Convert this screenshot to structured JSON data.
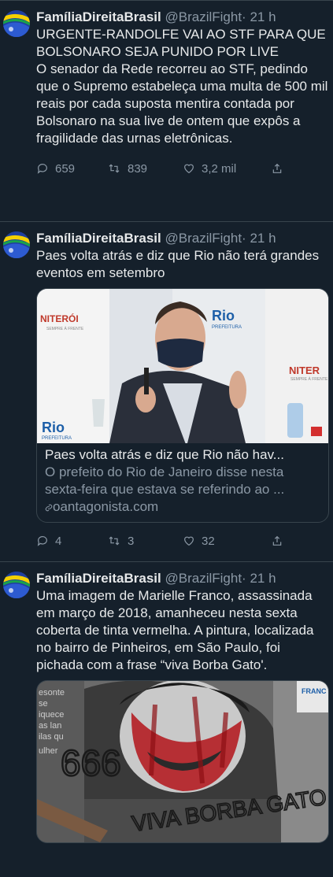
{
  "tweets": [
    {
      "name": "FamíliaDireitaBrasil",
      "handle": "@BrazilFight",
      "dot": "·",
      "time": "21 h",
      "lines": [
        "URGENTE-RANDOLFE VAI AO STF PARA QUE BOLSONARO SEJA PUNIDO POR LIVE",
        "O senador da Rede recorreu ao STF, pedindo que o Supremo estabeleça uma multa de 500 mil reais por cada suposta mentira contada por Bolsonaro na sua live de ontem que expôs a fragilidade das urnas eletrônicas."
      ],
      "replies": "659",
      "retweets": "839",
      "likes": "3,2 mil"
    },
    {
      "name": "FamíliaDireitaBrasil",
      "handle": "@BrazilFight",
      "dot": "·",
      "time": "21 h",
      "lines": [
        "Paes volta atrás e diz que Rio não terá grandes eventos em setembro"
      ],
      "card": {
        "title": "Paes volta atrás e diz que Rio não hav...",
        "description": "O prefeito do Rio de Janeiro disse nesta sexta-feira que estava se referindo ao ...",
        "domain": "oantagonista.com",
        "backdrop_left": "NITERÓI",
        "backdrop_left_sub": "SEMPRE À FRENTE",
        "backdrop_rio": "Rio",
        "backdrop_rio_sub": "PREFEITURA",
        "backdrop_right": "NITER",
        "backdrop_right_sub": "SEMPRE À FRENTE"
      },
      "replies": "4",
      "retweets": "3",
      "likes": "32"
    },
    {
      "name": "FamíliaDireitaBrasil",
      "handle": "@BrazilFight",
      "dot": "·",
      "time": "21 h",
      "lines": [
        "Uma imagem de Marielle Franco, assassinada em março de 2018, amanheceu nesta sexta coberta de tinta vermelha. A pintura, localizada no bairro de Pinheiros, em São Paulo, foi pichada com a frase “viva Borba Gato'."
      ],
      "media": {
        "graffiti": "VIVA BORBA GATO",
        "numbers": "666",
        "wall_text_1": "esonte",
        "wall_text_2": "se",
        "wall_text_3": "iquece",
        "wall_text_4": "as lan",
        "wall_text_5": "ilas qu",
        "wall_text_6": "ulher",
        "wall_text_7": "FRANC"
      }
    }
  ],
  "colors": {
    "background": "#15202b",
    "text": "#e7e9ea",
    "muted": "#8b98a5",
    "border": "#38444d"
  }
}
